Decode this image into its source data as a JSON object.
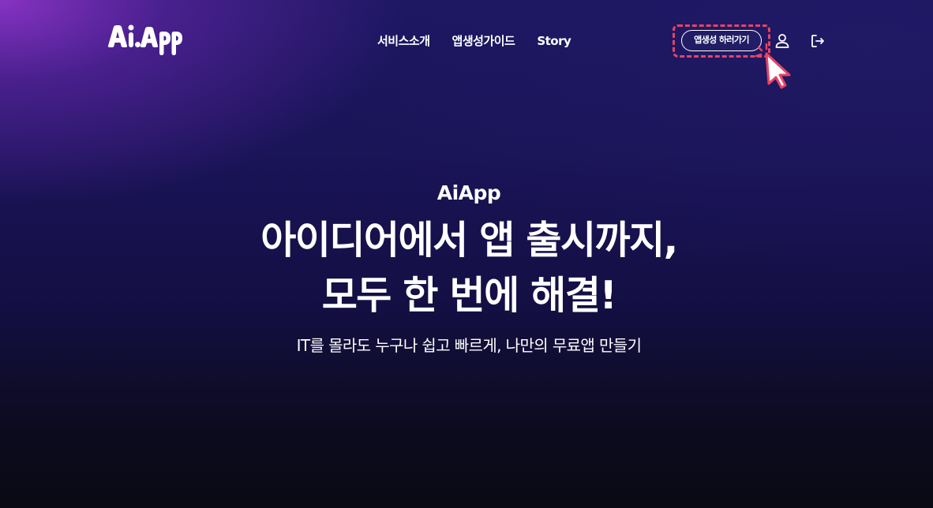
{
  "header": {
    "logo_text": "Ai.App",
    "nav": [
      {
        "label": "서비스소개"
      },
      {
        "label": "앱생성가이드"
      },
      {
        "label": "Story"
      }
    ],
    "cta_label": "앱생성 하러가기",
    "user_icon": "user-icon",
    "logout_icon": "logout-icon"
  },
  "hero": {
    "brand": "AiApp",
    "title_line1": "아이디어에서 앱 출시까지,",
    "title_line2": "모두 한 번에 해결!",
    "subtitle": "IT를 몰라도 누구나 쉽고 빠르게, 나만의 무료앱 만들기"
  },
  "colors": {
    "highlight": "#e54466",
    "text": "#ffffff",
    "background_top": "#1c1761",
    "background_bottom": "#0a0a15",
    "glow": "#8c34c8"
  }
}
